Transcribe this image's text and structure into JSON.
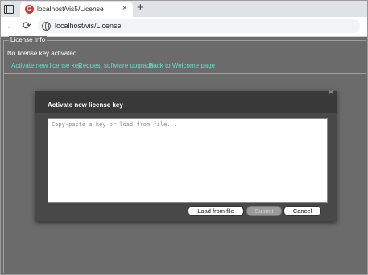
{
  "browser": {
    "tab": {
      "favicon_letter": "G",
      "title": "localhost/vis5/License",
      "close_glyph": "×"
    },
    "new_tab_glyph": "+",
    "nav": {
      "back_glyph": "←",
      "reload_glyph": "⟳"
    },
    "address": "localhost/vis/License"
  },
  "license_info": {
    "legend": "License Info",
    "status": "No license key activated.",
    "links": [
      {
        "label": "Activate new license key"
      },
      {
        "label": "Request software upgrade"
      },
      {
        "label": "Back to Welcome page"
      }
    ],
    "link_color": "#62e0c4"
  },
  "dialog": {
    "title": "Activate new license key",
    "minimize_glyph": "–",
    "close_glyph": "✕",
    "key_placeholder": "Copy-paste a key or load from file...",
    "buttons": {
      "load": "Load from file",
      "submit": "Submit",
      "cancel": "Cancel"
    }
  }
}
